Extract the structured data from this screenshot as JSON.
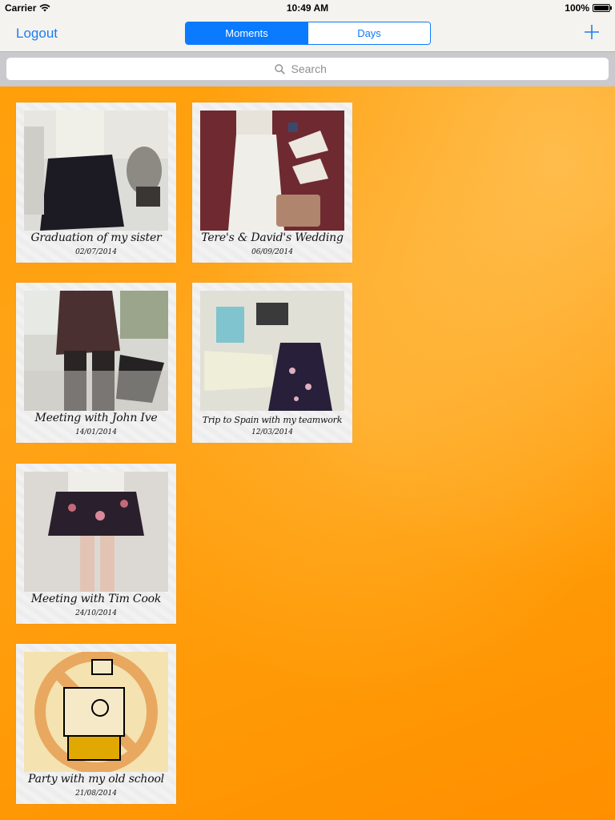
{
  "status_bar": {
    "carrier": "Carrier",
    "time": "10:49 AM",
    "battery": "100%"
  },
  "nav": {
    "logout_label": "Logout",
    "segments": [
      "Moments",
      "Days"
    ],
    "selected_segment": "Moments",
    "add_icon": "plus-icon"
  },
  "search": {
    "placeholder": "Search",
    "icon": "search-icon"
  },
  "colors": {
    "accent": "#0a7aff",
    "background": "#ff9f0a"
  },
  "moments": [
    {
      "title": "Graduation of my sister",
      "date": "02/07/2014"
    },
    {
      "title": "Tere's & David's Wedding",
      "date": "06/09/2014"
    },
    {
      "title": "Meeting with John Ive",
      "date": "14/01/2014"
    },
    {
      "title": "Trip to Spain with my teamwork",
      "date": "12/03/2014"
    },
    {
      "title": "Meeting with Tim Cook",
      "date": "24/10/2014"
    },
    {
      "title": "Party with my old school",
      "date": "21/08/2014"
    }
  ]
}
